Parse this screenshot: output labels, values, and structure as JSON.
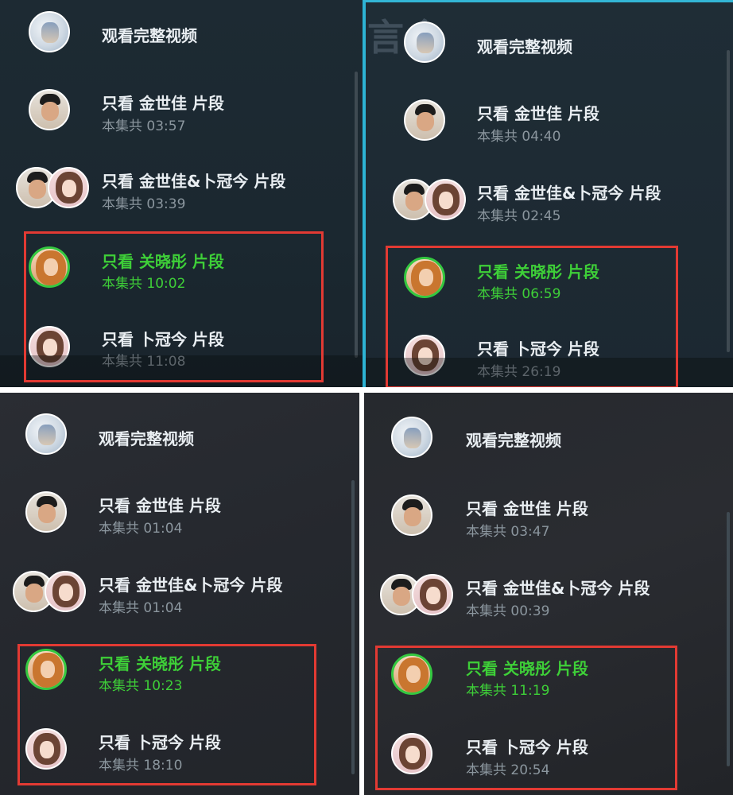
{
  "accent_colors": {
    "selected_text": "#3ecf38",
    "highlight_box": "#e23a33",
    "panel_border_cyan": "#2db3d4"
  },
  "panels": [
    {
      "full_video_label": "观看完整视频",
      "items": [
        {
          "title": "只看 金世佳 片段",
          "duration": "本集共 03:57",
          "avatar": "man-avatar"
        },
        {
          "title": "只看 金世佳&卜冠今 片段",
          "duration": "本集共 03:39",
          "avatar": "pair-avatar"
        },
        {
          "title": "只看 关晓彤 片段",
          "duration": "本集共 10:02",
          "avatar": "woman-avatar",
          "selected": true
        },
        {
          "title": "只看 卜冠今 片段",
          "duration": "本集共 11:08",
          "avatar": "woman2-avatar"
        }
      ]
    },
    {
      "full_video_label": "观看完整视频",
      "items": [
        {
          "title": "只看 金世佳 片段",
          "duration": "本集共 04:40",
          "avatar": "man-avatar"
        },
        {
          "title": "只看 金世佳&卜冠今 片段",
          "duration": "本集共 02:45",
          "avatar": "pair-avatar"
        },
        {
          "title": "只看 关晓彤 片段",
          "duration": "本集共 06:59",
          "avatar": "woman-avatar",
          "selected": true
        },
        {
          "title": "只看 卜冠今 片段",
          "duration": "本集共 26:19",
          "avatar": "woman2-avatar"
        }
      ]
    },
    {
      "full_video_label": "观看完整视频",
      "items": [
        {
          "title": "只看 金世佳 片段",
          "duration": "本集共 01:04",
          "avatar": "man-avatar"
        },
        {
          "title": "只看 金世佳&卜冠今 片段",
          "duration": "本集共 01:04",
          "avatar": "pair-avatar"
        },
        {
          "title": "只看 关晓彤 片段",
          "duration": "本集共 10:23",
          "avatar": "woman-avatar",
          "selected": true
        },
        {
          "title": "只看 卜冠今 片段",
          "duration": "本集共 18:10",
          "avatar": "woman2-avatar"
        }
      ]
    },
    {
      "full_video_label": "观看完整视频",
      "items": [
        {
          "title": "只看 金世佳 片段",
          "duration": "本集共 03:47",
          "avatar": "man-avatar"
        },
        {
          "title": "只看 金世佳&卜冠今 片段",
          "duration": "本集共 00:39",
          "avatar": "pair-avatar"
        },
        {
          "title": "只看 关晓彤 片段",
          "duration": "本集共 11:19",
          "avatar": "woman-avatar",
          "selected": true
        },
        {
          "title": "只看 卜冠今 片段",
          "duration": "本集共 20:54",
          "avatar": "woman2-avatar"
        }
      ]
    }
  ]
}
